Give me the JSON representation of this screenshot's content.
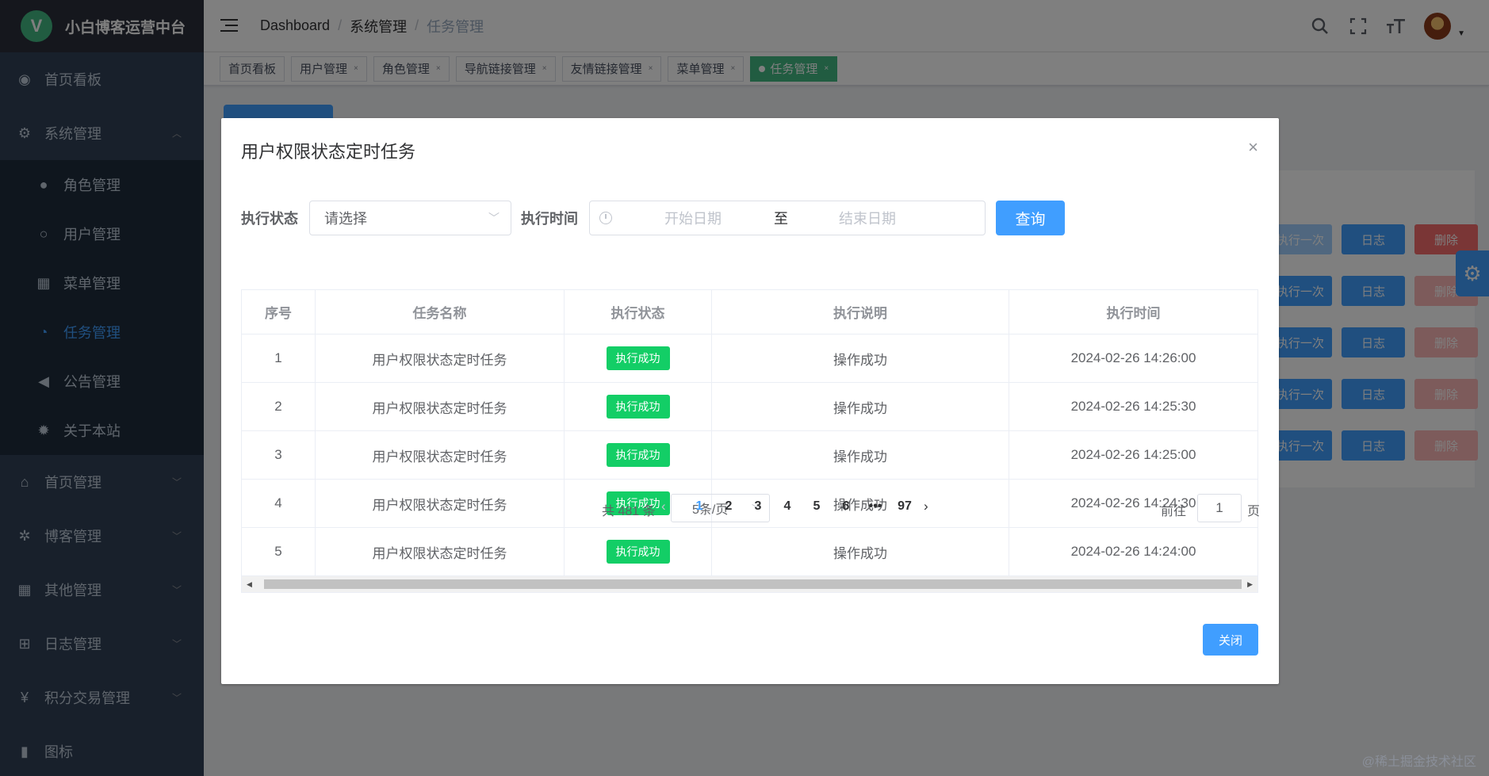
{
  "app": {
    "title": "小白博客运营中台",
    "logo_letter": "V"
  },
  "sidebar": {
    "items": [
      {
        "label": "首页看板",
        "icon": "dashboard-icon"
      },
      {
        "label": "系统管理",
        "icon": "gear-icon",
        "expanded": true
      },
      {
        "label": "首页管理",
        "icon": "home-icon"
      },
      {
        "label": "博客管理",
        "icon": "aperture-icon"
      },
      {
        "label": "其他管理",
        "icon": "grid-icon"
      },
      {
        "label": "日志管理",
        "icon": "document-add-icon"
      },
      {
        "label": "积分交易管理",
        "icon": "yen-icon"
      },
      {
        "label": "图标",
        "icon": "icon-icon"
      }
    ],
    "subitems": [
      {
        "label": "角色管理",
        "icon": "user-solid-icon"
      },
      {
        "label": "用户管理",
        "icon": "user-icon"
      },
      {
        "label": "菜单管理",
        "icon": "menu-icon"
      },
      {
        "label": "任务管理",
        "icon": "task-icon",
        "active": true
      },
      {
        "label": "公告管理",
        "icon": "speaker-icon"
      },
      {
        "label": "关于本站",
        "icon": "settings-icon"
      }
    ]
  },
  "breadcrumb": [
    "Dashboard",
    "系统管理",
    "任务管理"
  ],
  "breadcrumb_sep": "/",
  "tags": [
    {
      "label": "首页看板"
    },
    {
      "label": "用户管理"
    },
    {
      "label": "角色管理"
    },
    {
      "label": "导航链接管理"
    },
    {
      "label": "友情链接管理"
    },
    {
      "label": "菜单管理"
    },
    {
      "label": "任务管理",
      "active": true
    }
  ],
  "tag_close": "×",
  "background_buttons": {
    "run_once": "执行一次",
    "log": "日志",
    "delete": "删除"
  },
  "dialog": {
    "title": "用户权限状态定时任务",
    "close_symbol": "×",
    "filter": {
      "status_label": "执行状态",
      "status_placeholder": "请选择",
      "time_label": "执行时间",
      "start_placeholder": "开始日期",
      "range_separator": "至",
      "end_placeholder": "结束日期",
      "query_button": "查询"
    },
    "table": {
      "columns": [
        "序号",
        "任务名称",
        "执行状态",
        "执行说明",
        "执行时间"
      ],
      "rows": [
        {
          "index": "1",
          "name": "用户权限状态定时任务",
          "status": "执行成功",
          "message": "操作成功",
          "time": "2024-02-26 14:26:00"
        },
        {
          "index": "2",
          "name": "用户权限状态定时任务",
          "status": "执行成功",
          "message": "操作成功",
          "time": "2024-02-26 14:25:30"
        },
        {
          "index": "3",
          "name": "用户权限状态定时任务",
          "status": "执行成功",
          "message": "操作成功",
          "time": "2024-02-26 14:25:00"
        },
        {
          "index": "4",
          "name": "用户权限状态定时任务",
          "status": "执行成功",
          "message": "操作成功",
          "time": "2024-02-26 14:24:30"
        },
        {
          "index": "5",
          "name": "用户权限状态定时任务",
          "status": "执行成功",
          "message": "操作成功",
          "time": "2024-02-26 14:24:00"
        }
      ]
    },
    "pagination": {
      "total": "共 481 条",
      "page_size": "5条/页",
      "pages": [
        "1",
        "2",
        "3",
        "4",
        "5",
        "6",
        "•••",
        "97"
      ],
      "current": "1",
      "goto_label": "前往",
      "goto_value": "1",
      "page_suffix": "页"
    },
    "close_button": "关闭"
  },
  "watermark": "@稀土掘金技术社区",
  "colors": {
    "primary": "#409eff",
    "success": "#13ce66",
    "sidebar": "#304156",
    "tag_active": "#42b983"
  }
}
